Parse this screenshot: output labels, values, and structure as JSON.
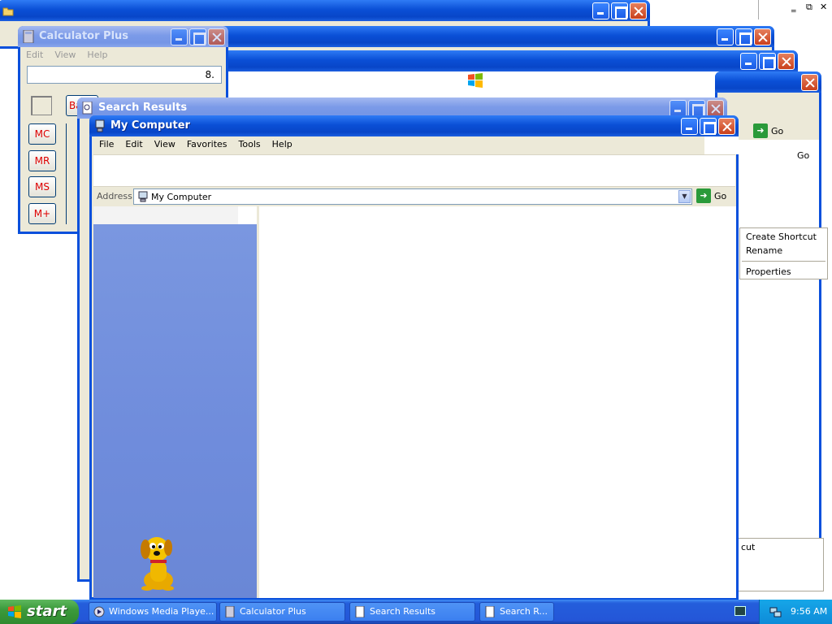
{
  "windows": {
    "back1": {
      "title": ""
    },
    "back2": {
      "title": ""
    },
    "back3": {
      "title": ""
    },
    "search_back": {
      "go_label": "Go",
      "go2_label": "Go",
      "shortcut_fragment": "cut"
    },
    "calculator": {
      "title": "Calculator Plus",
      "menu": [
        "Edit",
        "View",
        "Help"
      ],
      "display": "8.",
      "memory_buttons": [
        "MC",
        "MR",
        "MS",
        "M+"
      ],
      "backspace_fragment": "Ba"
    },
    "search_results": {
      "title": "Search Results"
    },
    "my_computer": {
      "title": "My Computer",
      "menu": [
        "File",
        "Edit",
        "View",
        "Favorites",
        "Tools",
        "Help"
      ],
      "address_label": "Address",
      "address_value": "My Computer",
      "go_label": "Go"
    }
  },
  "context_menu": {
    "items": [
      "Create Shortcut",
      "Rename",
      "Properties"
    ]
  },
  "taskbar": {
    "start_label": "start",
    "tasks": [
      "Windows Media Playe...",
      "Calculator Plus",
      "Search Results",
      "Search R..."
    ],
    "clock": "9:56 AM"
  },
  "colors": {
    "xp_blue": "#0a50dc",
    "start_green": "#3c9a3c",
    "sidebar_blue": "#7a96df"
  }
}
